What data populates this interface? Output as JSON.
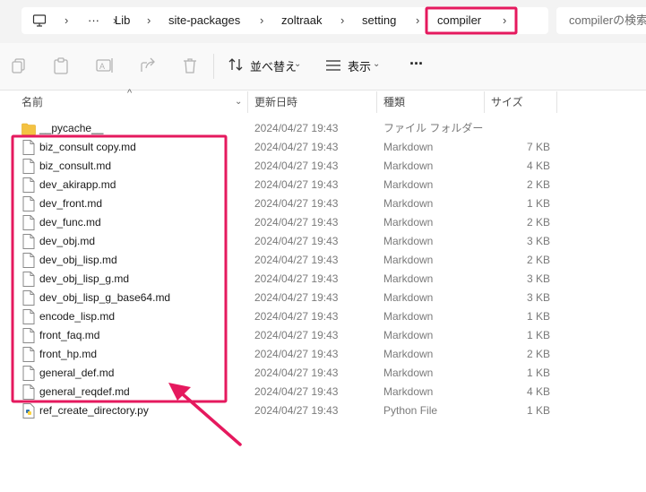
{
  "breadcrumb": {
    "items": [
      "Lib",
      "site-packages",
      "zoltraak",
      "setting",
      "compiler"
    ],
    "overflow": "···"
  },
  "search": {
    "placeholder": "compilerの検索"
  },
  "toolbar": {
    "sort_label": "並べ替え",
    "view_label": "表示",
    "more_label": "···"
  },
  "columns": {
    "name": "名前",
    "date": "更新日時",
    "type": "種類",
    "size": "サイズ"
  },
  "files": [
    {
      "name": "__pycache__",
      "date": "2024/04/27 19:43",
      "type": "ファイル フォルダー",
      "size": "",
      "kind": "folder"
    },
    {
      "name": "biz_consult copy.md",
      "date": "2024/04/27 19:43",
      "type": "Markdown",
      "size": "7 KB",
      "kind": "md"
    },
    {
      "name": "biz_consult.md",
      "date": "2024/04/27 19:43",
      "type": "Markdown",
      "size": "4 KB",
      "kind": "md"
    },
    {
      "name": "dev_akirapp.md",
      "date": "2024/04/27 19:43",
      "type": "Markdown",
      "size": "2 KB",
      "kind": "md"
    },
    {
      "name": "dev_front.md",
      "date": "2024/04/27 19:43",
      "type": "Markdown",
      "size": "1 KB",
      "kind": "md"
    },
    {
      "name": "dev_func.md",
      "date": "2024/04/27 19:43",
      "type": "Markdown",
      "size": "2 KB",
      "kind": "md"
    },
    {
      "name": "dev_obj.md",
      "date": "2024/04/27 19:43",
      "type": "Markdown",
      "size": "3 KB",
      "kind": "md"
    },
    {
      "name": "dev_obj_lisp.md",
      "date": "2024/04/27 19:43",
      "type": "Markdown",
      "size": "2 KB",
      "kind": "md"
    },
    {
      "name": "dev_obj_lisp_g.md",
      "date": "2024/04/27 19:43",
      "type": "Markdown",
      "size": "3 KB",
      "kind": "md"
    },
    {
      "name": "dev_obj_lisp_g_base64.md",
      "date": "2024/04/27 19:43",
      "type": "Markdown",
      "size": "3 KB",
      "kind": "md"
    },
    {
      "name": "encode_lisp.md",
      "date": "2024/04/27 19:43",
      "type": "Markdown",
      "size": "1 KB",
      "kind": "md"
    },
    {
      "name": "front_faq.md",
      "date": "2024/04/27 19:43",
      "type": "Markdown",
      "size": "1 KB",
      "kind": "md"
    },
    {
      "name": "front_hp.md",
      "date": "2024/04/27 19:43",
      "type": "Markdown",
      "size": "2 KB",
      "kind": "md"
    },
    {
      "name": "general_def.md",
      "date": "2024/04/27 19:43",
      "type": "Markdown",
      "size": "1 KB",
      "kind": "md"
    },
    {
      "name": "general_reqdef.md",
      "date": "2024/04/27 19:43",
      "type": "Markdown",
      "size": "4 KB",
      "kind": "md"
    },
    {
      "name": "ref_create_directory.py",
      "date": "2024/04/27 19:43",
      "type": "Python File",
      "size": "1 KB",
      "kind": "py"
    }
  ],
  "annotation_color": "#e5195e",
  "icons": [
    "computer-icon",
    "copy-icon",
    "paste-icon",
    "rename-icon",
    "share-icon",
    "delete-icon",
    "sort-icon",
    "view-icon"
  ]
}
